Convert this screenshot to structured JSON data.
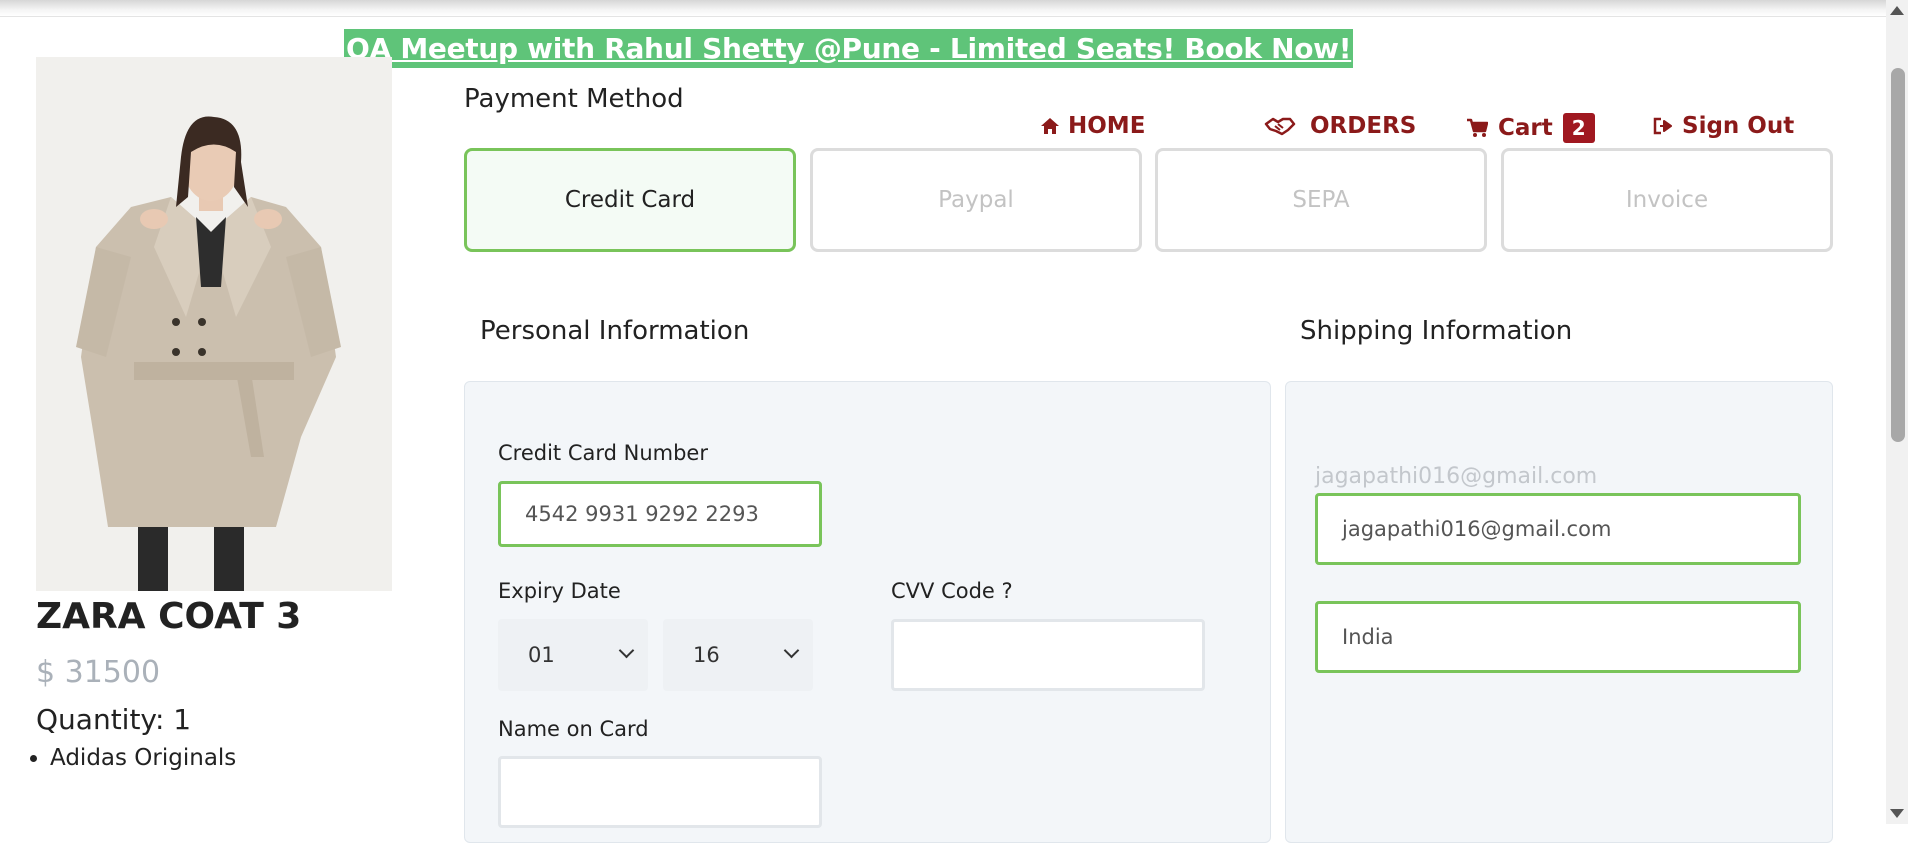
{
  "banner": {
    "text": "QA Meetup with Rahul Shetty @Pune - Limited Seats! Book Now!"
  },
  "nav": {
    "home": "HOME",
    "orders": "ORDERS",
    "cart": "Cart",
    "cart_count": "2",
    "signout": "Sign Out"
  },
  "product": {
    "title": "ZARA COAT 3",
    "price": "$ 31500",
    "quantity": "Quantity: 1",
    "items": [
      "Adidas Originals"
    ]
  },
  "payment": {
    "title": "Payment Method",
    "methods": [
      "Credit Card",
      "Paypal",
      "SEPA",
      "Invoice"
    ],
    "selected": "Credit Card"
  },
  "personal": {
    "title": "Personal Information",
    "cc_label": "Credit Card Number",
    "cc_value": "4542 9931 9292 2293",
    "expiry_label": "Expiry Date",
    "expiry_month": "01",
    "expiry_year": "16",
    "cvv_label": "CVV Code ?",
    "cvv_value": "",
    "name_label": "Name on Card",
    "name_value": ""
  },
  "shipping": {
    "title": "Shipping Information",
    "email_label": "jagapathi016@gmail.com",
    "email_value": "jagapathi016@gmail.com",
    "country_value": "India"
  },
  "colors": {
    "accent_green": "#79c45a",
    "banner_green": "#5fc479",
    "nav_red": "#8b1a1a",
    "panel_bg": "#f3f6f9"
  }
}
